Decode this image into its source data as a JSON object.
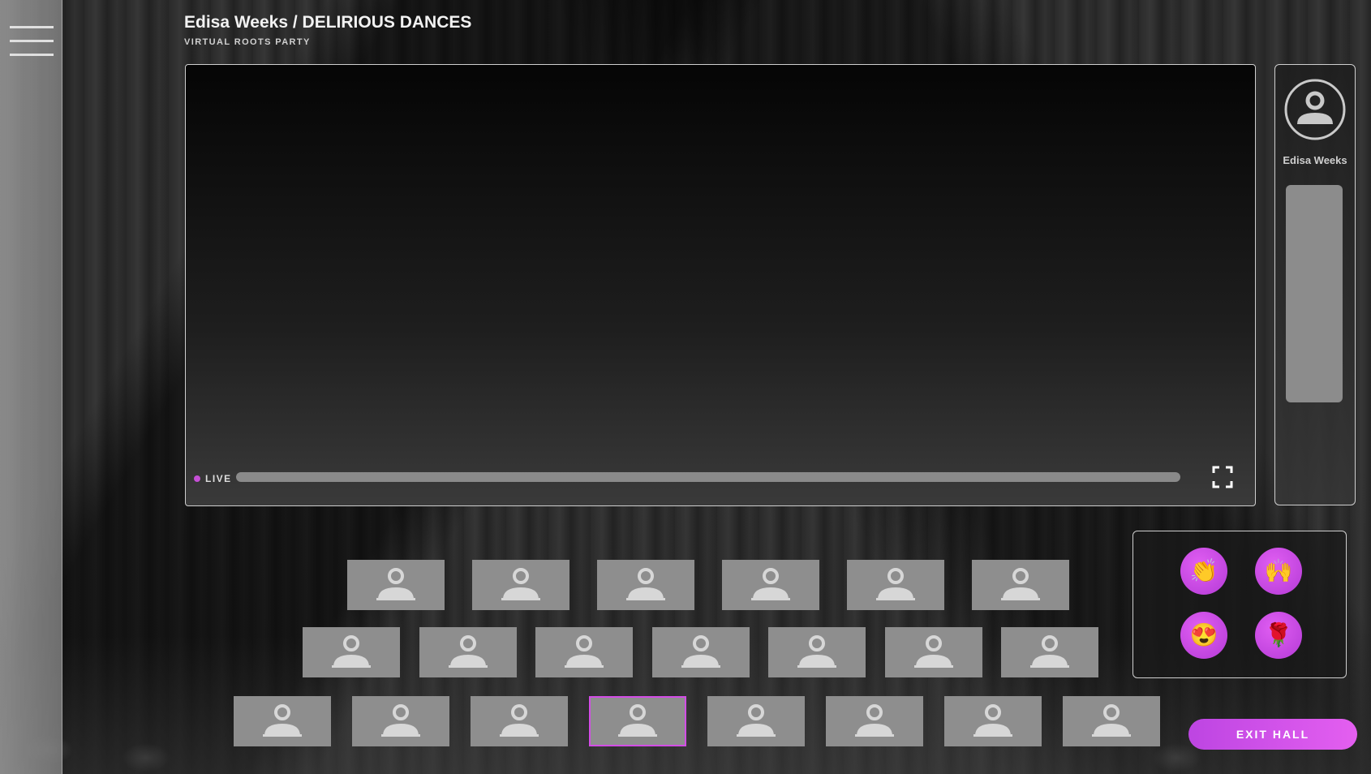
{
  "header": {
    "title": "Edisa Weeks / DELIRIOUS DANCES",
    "subtitle": "VIRTUAL ROOTS PARTY"
  },
  "player": {
    "live_label": "LIVE",
    "status_color": "#c64fd6"
  },
  "presenter": {
    "name": "Edisa Weeks",
    "icon": "user-avatar-icon"
  },
  "audience": {
    "rows": [
      6,
      7,
      8
    ],
    "selected_row": 2,
    "selected_index": 3,
    "seat_icon": "user-icon",
    "highlight_color": "#d34de6"
  },
  "reactions": [
    {
      "name": "clap-reaction",
      "emoji": "👏"
    },
    {
      "name": "raise-hands-reaction",
      "emoji": "🙌"
    },
    {
      "name": "heart-eyes-reaction",
      "emoji": "😍"
    },
    {
      "name": "rose-reaction",
      "emoji": "🌹"
    }
  ],
  "exit_button": {
    "label": "EXIT HALL"
  },
  "accent_color": "#c64fd6"
}
